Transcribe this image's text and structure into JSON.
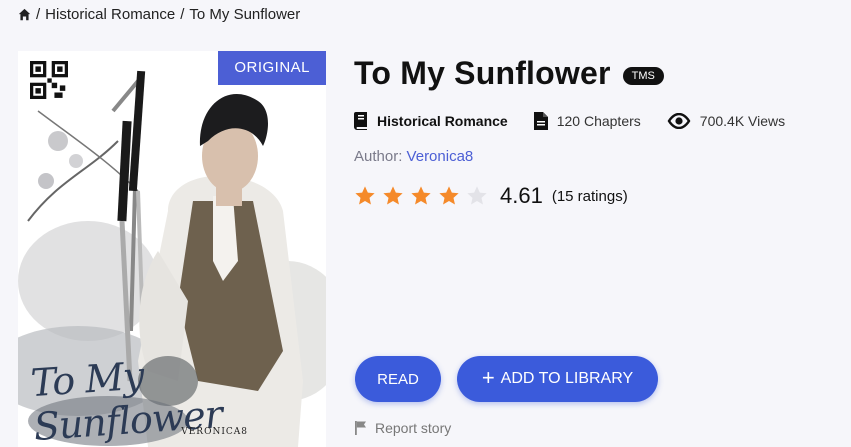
{
  "breadcrumb": {
    "home_icon": "home-icon",
    "sep1": "/",
    "category": "Historical Romance",
    "sep2": "/",
    "current": "To My Sunflower"
  },
  "cover": {
    "badge": "ORIGINAL",
    "title_text": "To My Sunflower",
    "signature": "VERONICA8"
  },
  "book": {
    "title": "To My Sunflower",
    "abbr": "TMS",
    "genre": "Historical Romance",
    "chapters": "120 Chapters",
    "views": "700.4K Views",
    "author_label": "Author:",
    "author_name": "Veronica8",
    "rating_value": 4.61,
    "rating_score": "4.61",
    "rating_count": "(15 ratings)",
    "stars_filled": 4,
    "stars_total": 5
  },
  "actions": {
    "read_label": "READ",
    "library_plus": "+",
    "library_label": "ADD TO LIBRARY",
    "report_label": "Report story"
  },
  "colors": {
    "accent": "#3b5bdb",
    "badge": "#4c5fd5",
    "star_filled": "#f58a2a",
    "star_empty": "#e3e3e8"
  }
}
